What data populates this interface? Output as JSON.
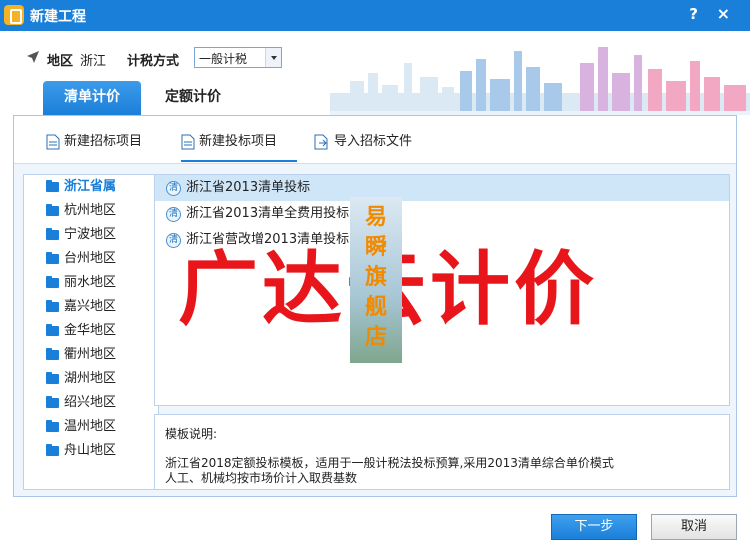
{
  "window": {
    "title": "新建工程",
    "help": "?",
    "close": "×"
  },
  "header": {
    "region_label": "地区",
    "region_value": "浙江",
    "tax_label": "计税方式",
    "tax_value": "一般计税"
  },
  "tabs": [
    {
      "label": "清单计价",
      "active": true
    },
    {
      "label": "定额计价",
      "active": false
    }
  ],
  "toolbar": [
    {
      "label": "新建招标项目"
    },
    {
      "label": "新建投标项目",
      "active": true
    },
    {
      "label": "导入招标文件"
    }
  ],
  "regions": [
    "浙江省属",
    "杭州地区",
    "宁波地区",
    "台州地区",
    "丽水地区",
    "嘉兴地区",
    "金华地区",
    "衢州地区",
    "湖州地区",
    "绍兴地区",
    "温州地区",
    "舟山地区"
  ],
  "templates": [
    {
      "icon_text": "清",
      "label": "浙江省2013清单投标"
    },
    {
      "icon_text": "清",
      "label": "浙江省2013清单全费用投标"
    },
    {
      "icon_text": "清",
      "label": "浙江省营改增2013清单投标"
    }
  ],
  "description": {
    "label": "模板说明:",
    "line1": "浙江省2018定额投标模板，适用于一般计税法投标预算,采用2013清单综合单价模式",
    "line2": "人工、机械均按市场价计入取费基数"
  },
  "buttons": {
    "next": "下一步",
    "cancel": "取消"
  },
  "watermark": {
    "main": "广达云计价",
    "badge": [
      "易",
      "瞬",
      "旗",
      "舰",
      "店"
    ]
  },
  "colors": {
    "accent": "#1a7fd8",
    "watermark_red": "#e8161b",
    "badge_orange": "#f08a00"
  }
}
